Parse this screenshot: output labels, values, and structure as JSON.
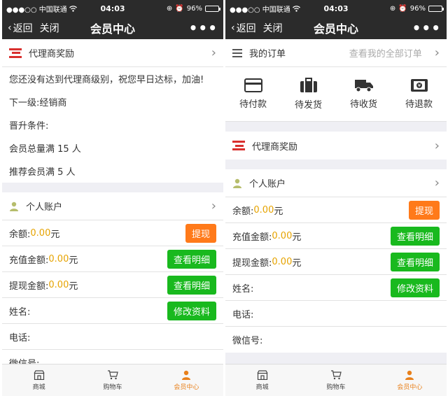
{
  "status_bar": {
    "carrier": "●●●○○ 中国联通",
    "time": "04:03",
    "battery": "96%",
    "battery_level": 0.96
  },
  "nav": {
    "back": "返回",
    "close": "关闭",
    "title": "会员中心",
    "more": "•••"
  },
  "left": {
    "agent_title": "代理商奖励",
    "agent_msg": "您还没有达到代理商级别，祝您早日达标，加油!",
    "next_level": "下一级:经销商",
    "upgrade": "晋升条件:",
    "cond1": "会员总量满 15 人",
    "cond2": "推荐会员满 5 人"
  },
  "orders": {
    "title": "我的订单",
    "view_all": "查看我的全部订单",
    "items": [
      {
        "label": "待付款",
        "icon": "card-icon"
      },
      {
        "label": "待发货",
        "icon": "briefcase-icon"
      },
      {
        "label": "待收货",
        "icon": "truck-icon"
      },
      {
        "label": "待退款",
        "icon": "refund-icon"
      }
    ]
  },
  "account": {
    "title": "个人账户",
    "balance_label": "余额:",
    "balance_value": "0.00",
    "recharge_label": "充值金额:",
    "recharge_value": "0.00",
    "withdraw_label": "提现金额:",
    "withdraw_value": "0.00",
    "currency": "元",
    "withdraw_btn": "提现",
    "detail_btn": "查看明细",
    "name_label": "姓名:",
    "edit_btn": "修改资料",
    "phone_label": "电话:",
    "wechat_label": "微信号:"
  },
  "agent_title_right": "代理商奖励",
  "tabbar": {
    "shop": "商城",
    "cart": "购物车",
    "member": "会员中心"
  },
  "colors": {
    "accent": "#e8801b",
    "green": "#19b91e",
    "orange": "#ff7a1a",
    "amount": "#e6a300",
    "brand_red": "#d9302e"
  }
}
